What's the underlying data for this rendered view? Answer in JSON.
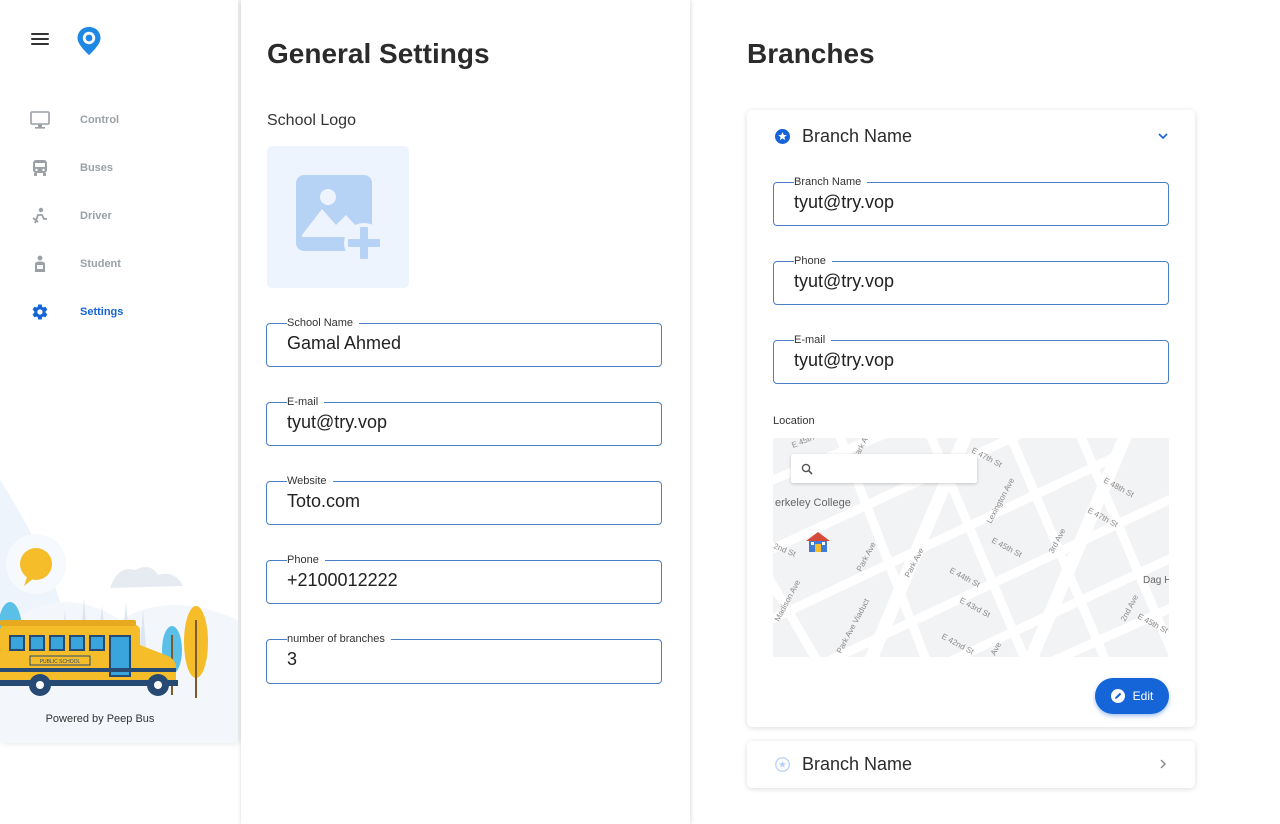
{
  "sidebar": {
    "items": [
      {
        "label": "Control",
        "icon": "monitor-icon"
      },
      {
        "label": "Buses",
        "icon": "bus-icon"
      },
      {
        "label": "Driver",
        "icon": "driver-icon"
      },
      {
        "label": "Student",
        "icon": "student-icon"
      },
      {
        "label": "Settings",
        "icon": "gear-icon",
        "active": true
      }
    ],
    "powered_by": "Powered by Peep Bus",
    "bus_sign": "PUBLIC SCHOOL"
  },
  "general": {
    "title": "General Settings",
    "logo_label": "School Logo",
    "fields": {
      "school_name": {
        "label": "School Name",
        "value": "Gamal Ahmed"
      },
      "email": {
        "label": "E-mail",
        "value": "tyut@try.vop"
      },
      "website": {
        "label": "Website",
        "value": "Toto.com"
      },
      "phone": {
        "label": "Phone",
        "value": "+2100012222"
      },
      "branches_count": {
        "label": "number of branches",
        "value": "3"
      }
    }
  },
  "branches": {
    "title": "Branches",
    "expanded": {
      "title": "Branch Name",
      "fields": {
        "name": {
          "label": "Branch Name",
          "value": "tyut@try.vop"
        },
        "phone": {
          "label": "Phone",
          "value": "tyut@try.vop"
        },
        "email": {
          "label": "E-mail",
          "value": "tyut@try.vop"
        }
      },
      "location_label": "Location",
      "edit_label": "Edit",
      "map": {
        "labels": [
          "erkeley College",
          "E 45th St",
          "Park Ave",
          "E 47th St",
          "Lexington Ave",
          "E 48th St",
          "E 47th St",
          "3rd Ave",
          "E 45th St",
          "2nd St",
          "Park Ave",
          "Park Ave",
          "E 44th St",
          "Madison Ave",
          "Park Ave Viaduct",
          "E 43rd St",
          "2nd Ave",
          "E 45th St",
          "E 42nd St",
          "Dag H",
          "Ave"
        ]
      }
    },
    "collapsed": {
      "title": "Branch Name"
    }
  },
  "colors": {
    "accent": "#1565d8",
    "field_border": "#4a7fc7",
    "logo_bg": "#eef4fd",
    "logo_icon": "#b6d3f6"
  }
}
